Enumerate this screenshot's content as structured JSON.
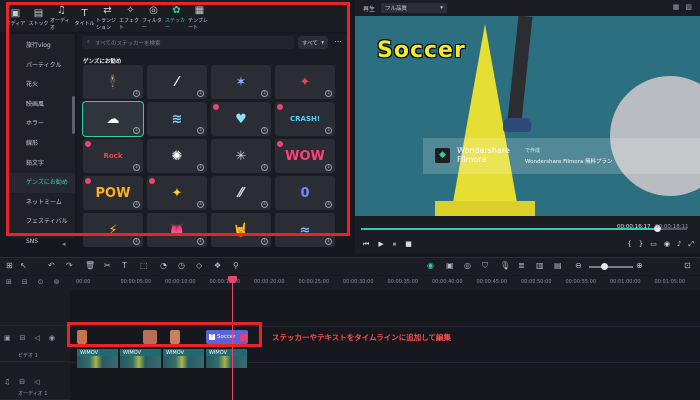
{
  "media_tabs": [
    {
      "label": "メディア",
      "icon": "▣"
    },
    {
      "label": "ストック",
      "icon": "▤"
    },
    {
      "label": "オーディオ",
      "icon": "♫"
    },
    {
      "label": "タイトル",
      "icon": "T"
    },
    {
      "label": "トランジション",
      "icon": "⇄"
    },
    {
      "label": "エフェクト",
      "icon": "✧"
    },
    {
      "label": "フィルター",
      "icon": "◎"
    },
    {
      "label": "ステッカー",
      "icon": "✿"
    },
    {
      "label": "テンプレート",
      "icon": "▦"
    }
  ],
  "active_tab_index": 7,
  "categories": [
    "旅行vlog",
    "パーティクル",
    "花火",
    "映画風",
    "ホラー",
    "線形",
    "鉛文字",
    "ゲンズにお勧め",
    "ネットミーム",
    "フェスティバル",
    "SNS"
  ],
  "active_category_index": 7,
  "search": {
    "placeholder": "すべてのステッカーを検索"
  },
  "filter": {
    "label": "すべて"
  },
  "section_title": "ゲンズにお勧め",
  "sticker_grid": [
    {
      "glyph": "🕴",
      "color": "#e64848",
      "gem": false
    },
    {
      "glyph": "⁄",
      "color": "#e8e8f0",
      "gem": false
    },
    {
      "glyph": "✶",
      "color": "#8fb3ff",
      "gem": false
    },
    {
      "glyph": "✦",
      "color": "#e64848",
      "gem": false
    },
    {
      "glyph": "☁",
      "color": "#ffffff",
      "gem": false
    },
    {
      "glyph": "≋",
      "color": "#7fd0ff",
      "gem": false
    },
    {
      "glyph": "♥",
      "color": "#8fe0ff",
      "gem": true
    },
    {
      "glyph": "CRASH!",
      "color": "#5bd0ff",
      "gem": true
    },
    {
      "glyph": "Rock",
      "color": "#e64848",
      "gem": true
    },
    {
      "glyph": "✺",
      "color": "#ffffff",
      "gem": false
    },
    {
      "glyph": "✳",
      "color": "#cfd6e0",
      "gem": false
    },
    {
      "glyph": "WOW",
      "color": "#ff3f7a",
      "gem": true
    },
    {
      "glyph": "POW",
      "color": "#ffb020",
      "gem": true
    },
    {
      "glyph": "✦",
      "color": "#ffcc3a",
      "gem": true
    },
    {
      "glyph": "⁄⁄",
      "color": "#e6e8ea",
      "gem": false
    },
    {
      "glyph": "0",
      "color": "#6f8bff",
      "gem": false
    },
    {
      "glyph": "⚡",
      "color": "#ffb020",
      "gem": false
    },
    {
      "glyph": "👅",
      "color": "#ff6a6a",
      "gem": false
    },
    {
      "glyph": "🤘",
      "color": "#ff7a3a",
      "gem": false
    },
    {
      "glyph": "≈",
      "color": "#7fb8ff",
      "gem": false
    }
  ],
  "player": {
    "label": "再生",
    "quality": "フル品質",
    "video_title": "Soccer",
    "watermark_name": "Wondershare Filmora",
    "watermark_sub": "で作成",
    "watermark_text": "Wondershare Filmora 無料プラン",
    "time_current": "00:00:16:17",
    "time_total": "00:00:18:11",
    "progress": 0.91
  },
  "ruler_ticks": [
    "00:00",
    "00:00:05:00",
    "00:00:10:00",
    "00:00:15:00",
    "00:00:20:00",
    "00:00:25:00",
    "00:00:30:00",
    "00:00:35:00",
    "00:00:40:00",
    "00:00:45:00",
    "00:00:50:00",
    "00:00:55:00",
    "00:01:00:00",
    "00:01:05:00"
  ],
  "tracks": {
    "track2_label": "ビデオ 1",
    "track1_label": "オーディオ 1",
    "text_clip": "Soccer",
    "video_clips": [
      "WIMOV",
      "WIMOV",
      "WIMOV",
      "WIMOV"
    ]
  },
  "annotation": "ステッカーやテキストをタイムラインに追加して編集"
}
